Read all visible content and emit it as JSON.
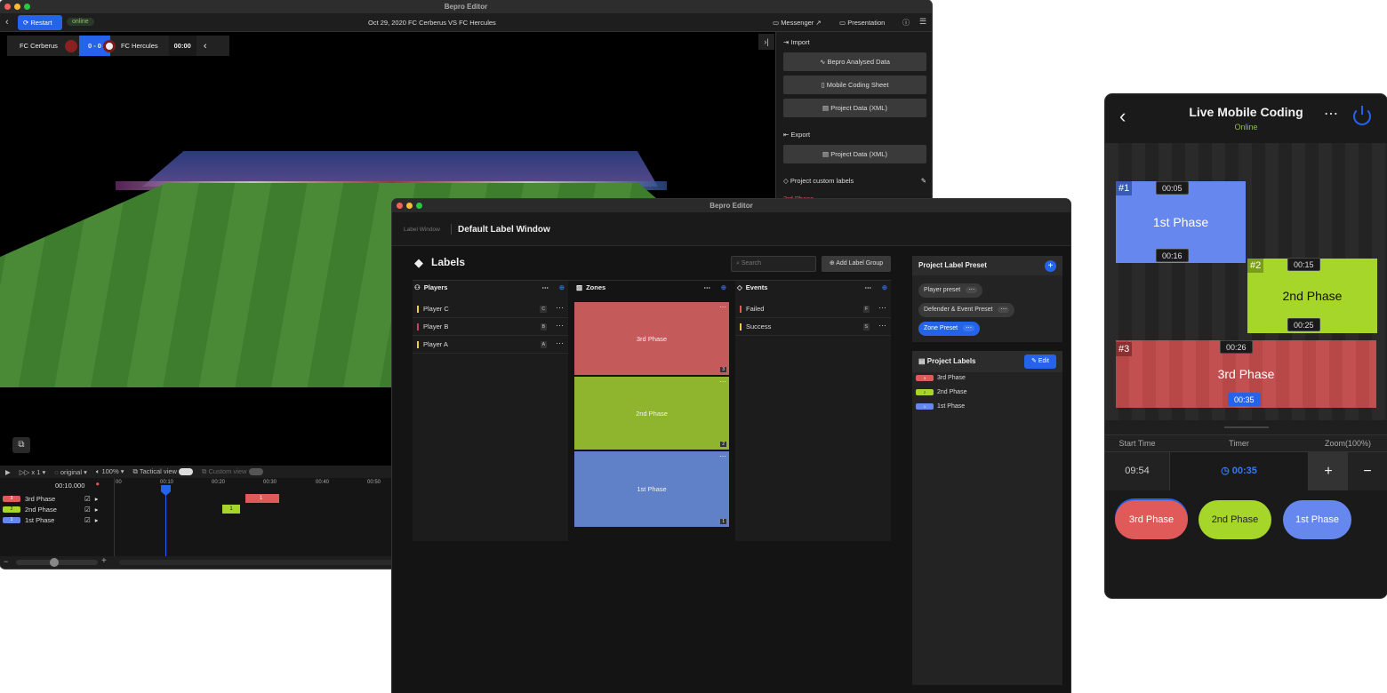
{
  "w1": {
    "title": "Bepro Editor",
    "restart": "Restart",
    "online": "online",
    "match": "Oct 29, 2020 FC Cerberus VS FC Hercules",
    "messenger": "Messenger",
    "presentation": "Presentation",
    "team_home": "FC Cerberus",
    "score": "0 - 0",
    "team_away": "FC Hercules",
    "clock": "00:00",
    "import": "Import",
    "btn_analysed": "Bepro Analysed Data",
    "btn_mobile": "Mobile Coding Sheet",
    "btn_xml_import": "Project Data (XML)",
    "export": "Export",
    "btn_xml_export": "Project Data (XML)",
    "custom_labels": "Project custom labels",
    "custom_label_1": "3rd Phase",
    "speed": "x 1",
    "quality": "original",
    "volume": "100%",
    "tactical": "Tactical view",
    "custom_view": "Custom view",
    "current_time": "00:10.000",
    "ticks": [
      "00",
      "00:10",
      "00:20",
      "00:30",
      "00:40",
      "00:50"
    ],
    "tracks": [
      {
        "num": "3",
        "name": "3rd Phase",
        "color": "#e05a5a"
      },
      {
        "num": "2",
        "name": "2nd Phase",
        "color": "#a7d62a"
      },
      {
        "num": "1",
        "name": "1st Phase",
        "color": "#6688ee"
      }
    ],
    "clip_1": "1",
    "clip_2": "1"
  },
  "w2": {
    "title": "Bepro Editor",
    "crumb": "Label Window",
    "window_name": "Default Label Window",
    "labels_title": "Labels",
    "search_placeholder": "Search",
    "add_group": "Add Label Group",
    "players_head": "Players",
    "players": [
      {
        "name": "Player C",
        "key": "C",
        "color": "#e8d23a"
      },
      {
        "name": "Player B",
        "key": "B",
        "color": "#b44a5a"
      },
      {
        "name": "Player A",
        "key": "A",
        "color": "#e8d23a"
      }
    ],
    "zones_head": "Zones",
    "zones": [
      {
        "name": "3rd Phase",
        "key": "3",
        "color": "#c55a5a"
      },
      {
        "name": "2nd Phase",
        "key": "2",
        "color": "#8fb52e"
      },
      {
        "name": "1st Phase",
        "key": "1",
        "color": "#6080c8"
      }
    ],
    "events_head": "Events",
    "events": [
      {
        "name": "Failed",
        "key": "F",
        "color": "#e05a5a"
      },
      {
        "name": "Success",
        "key": "S",
        "color": "#e8d23a"
      }
    ],
    "preset_title": "Project Label Preset",
    "presets": [
      "Player preset",
      "Defender & Event Preset",
      "Zone Preset"
    ],
    "project_labels_title": "Project Labels",
    "edit": "Edit",
    "project_labels": [
      {
        "name": "3rd Phase",
        "num": "3",
        "color": "#e05a5a"
      },
      {
        "name": "2nd Phase",
        "num": "2",
        "color": "#a7d62a"
      },
      {
        "name": "1st Phase",
        "num": "1",
        "color": "#6688ee"
      }
    ]
  },
  "w3": {
    "title": "Live Mobile Coding",
    "status": "Online",
    "boxes": [
      {
        "num": "#1",
        "name": "1st Phase",
        "t1": "00:05",
        "t2": "00:16"
      },
      {
        "num": "#2",
        "name": "2nd Phase",
        "t1": "00:15",
        "t2": "00:25"
      },
      {
        "num": "#3",
        "name": "3rd Phase",
        "t1": "00:26",
        "t2": "00:35"
      }
    ],
    "start_time_label": "Start Time",
    "timer_label": "Timer",
    "zoom_label": "Zoom(100%)",
    "start_time": "09:54",
    "timer": "00:35",
    "plus": "+",
    "minus": "−",
    "buttons": [
      "3rd Phase",
      "2nd Phase",
      "1st Phase"
    ]
  }
}
